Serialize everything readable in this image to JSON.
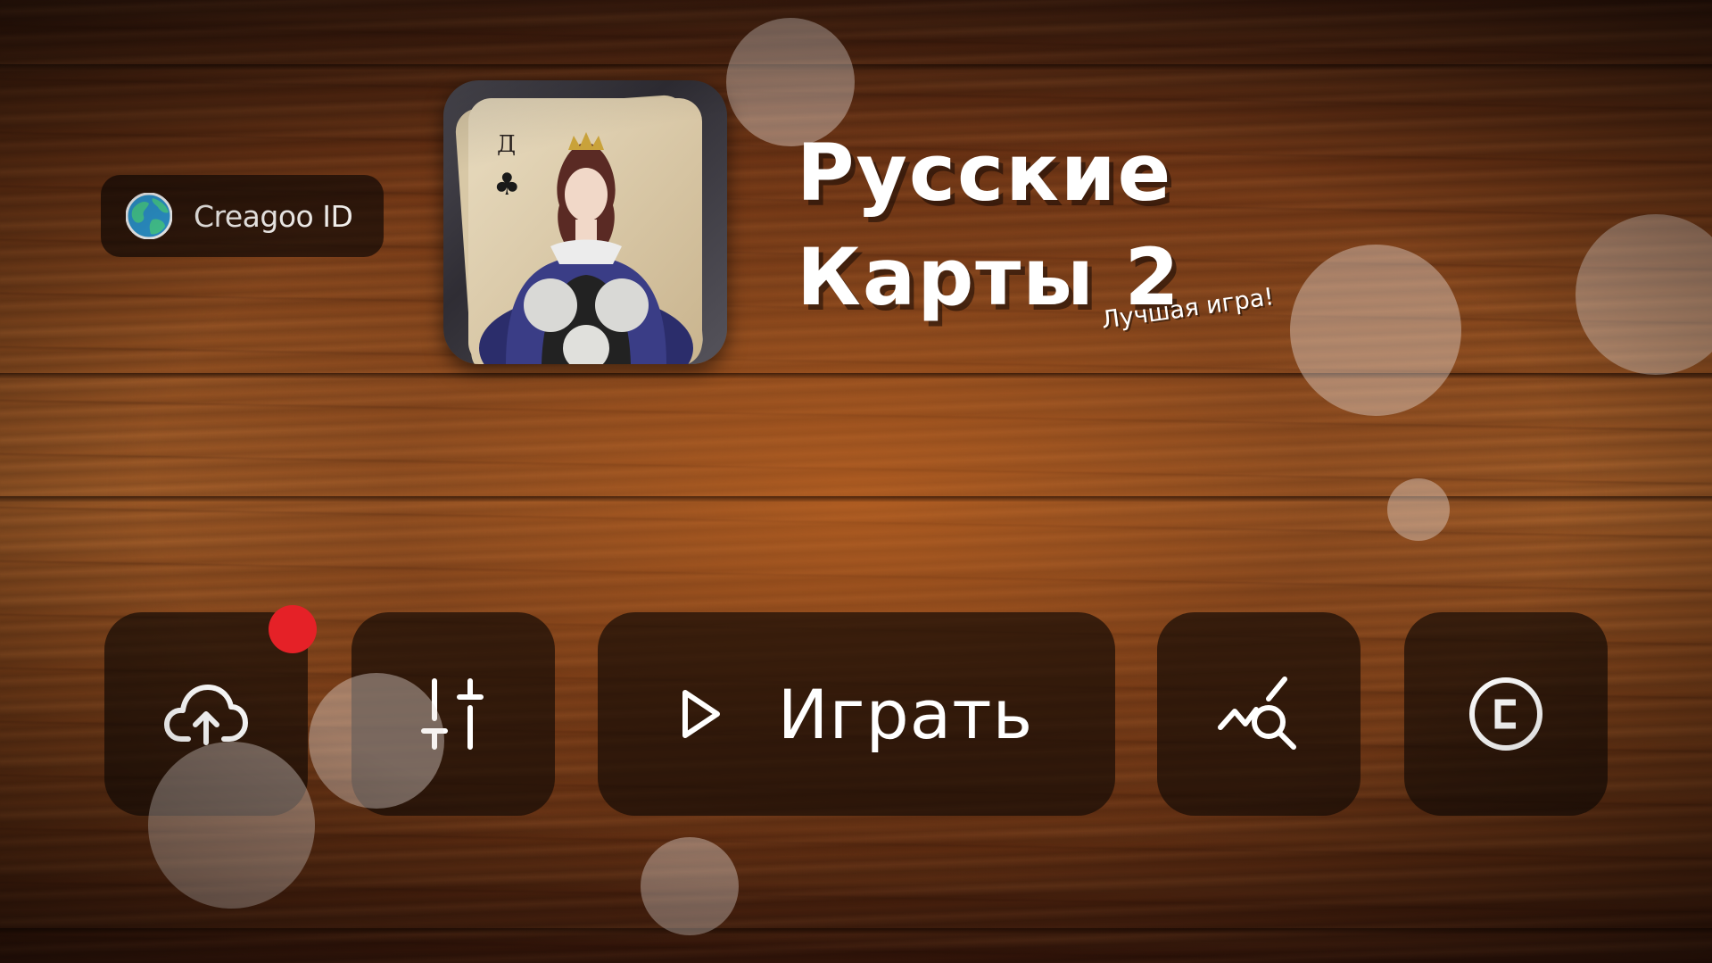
{
  "colors": {
    "accent_notification": "#e52127",
    "text": "#ffffff",
    "panel": "rgba(22,11,6,0.70)"
  },
  "account": {
    "label": "Creagoo ID",
    "icon": "globe-icon"
  },
  "game": {
    "title": "Русские\nКарты 2",
    "tagline": "Лучшая игра!",
    "cover": {
      "icon": "queen-of-clubs-card",
      "card_rank": "Д",
      "card_suit": "♣"
    }
  },
  "menu": {
    "cloud_sync": {
      "icon": "cloud-upload-icon",
      "has_notification": true
    },
    "settings": {
      "icon": "sliders-icon"
    },
    "play": {
      "icon": "play-icon",
      "label": "Играть"
    },
    "stats": {
      "icon": "stats-search-icon"
    },
    "copyright": {
      "icon": "copyright-icon"
    }
  }
}
